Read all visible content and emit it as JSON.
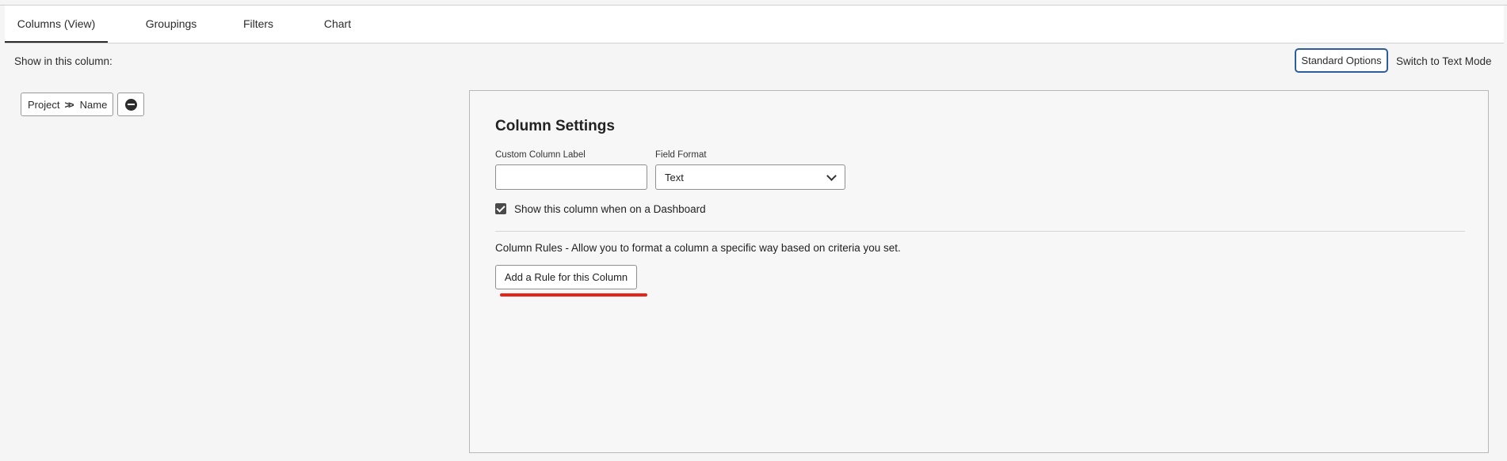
{
  "tabs": [
    {
      "label": "Columns (View)",
      "active": true
    },
    {
      "label": "Groupings",
      "active": false
    },
    {
      "label": "Filters",
      "active": false
    },
    {
      "label": "Chart",
      "active": false
    }
  ],
  "toolbar": {
    "show_label": "Show in this column:",
    "standard_options": "Standard Options",
    "text_mode": "Switch to Text Mode"
  },
  "field_path": {
    "object": "Project",
    "separator_icon": "double-chevron-right-icon",
    "field": "Name",
    "remove_icon": "minus-circle-icon"
  },
  "column_settings": {
    "title": "Column Settings",
    "custom_label": {
      "label": "Custom Column Label",
      "value": "",
      "placeholder": ""
    },
    "field_format": {
      "label": "Field Format",
      "selected": "Text"
    },
    "dashboard_checkbox": {
      "label": "Show this column when on a Dashboard",
      "checked": true
    },
    "rules_description": "Column Rules - Allow you to format a column a specific way based on criteria you set.",
    "add_rule_button": "Add a Rule for this Column"
  },
  "colors": {
    "accent_border": "#2f5d9c",
    "highlight_underline": "#e3251a",
    "background": "#f5f5f5"
  }
}
